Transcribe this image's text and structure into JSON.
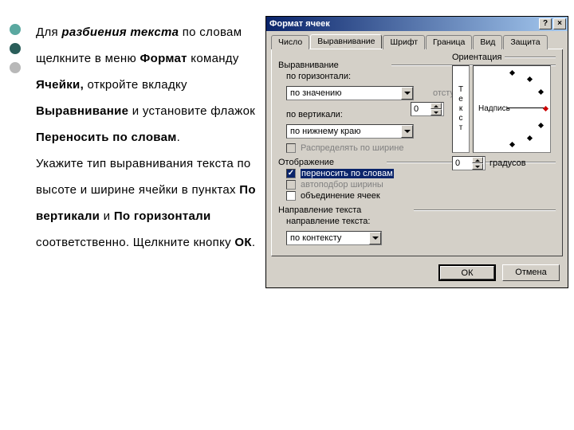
{
  "bullets": [
    {
      "color": "#5aa8a0"
    },
    {
      "color": "#2a5e5a"
    },
    {
      "color": "#b8b8b8"
    }
  ],
  "instructionsHtml": "Для <b><i>разбиения текста</i></b> по словам щелкните в меню <b>Формат</b> команду <b>Ячейки,</b> откройте вкладку <b>Выравнивание</b> и установите флажок <br><b>Переносить по словам</b>. <br>Укажите тип выравнивания текста по высоте и ширине ячейки в пунктах <b>По вертикали</b> и <b>По горизонтали</b> соответственно. Щелкните кнопку <b>ОК</b>.",
  "dialog": {
    "title": "Формат ячеек",
    "helpBtn": "?",
    "closeBtn": "×",
    "tabs": [
      "Число",
      "Выравнивание",
      "Шрифт",
      "Граница",
      "Вид",
      "Защита"
    ],
    "activeTab": 1,
    "sections": {
      "alignment": "Выравнивание",
      "horizLabel": "по горизонтали:",
      "horizValue": "по значению",
      "indentLabel": "отступ:",
      "indentValue": "0",
      "vertLabel": "по вертикали:",
      "vertValue": "по нижнему краю",
      "distribute": "Распределять по ширине",
      "display": "Отображение",
      "wrap": "переносить по словам",
      "autofit": "автоподбор ширины",
      "merge": "объединение ячеек",
      "textdir": "Направление текста",
      "dirlabel": "направление текста:",
      "dirvalue": "по контексту",
      "orientation": "Ориентация",
      "vtext": "Текст",
      "arcLabel": "Надпись",
      "degValue": "0",
      "degLabel": "градусов"
    },
    "buttons": {
      "ok": "ОК",
      "cancel": "Отмена"
    }
  }
}
